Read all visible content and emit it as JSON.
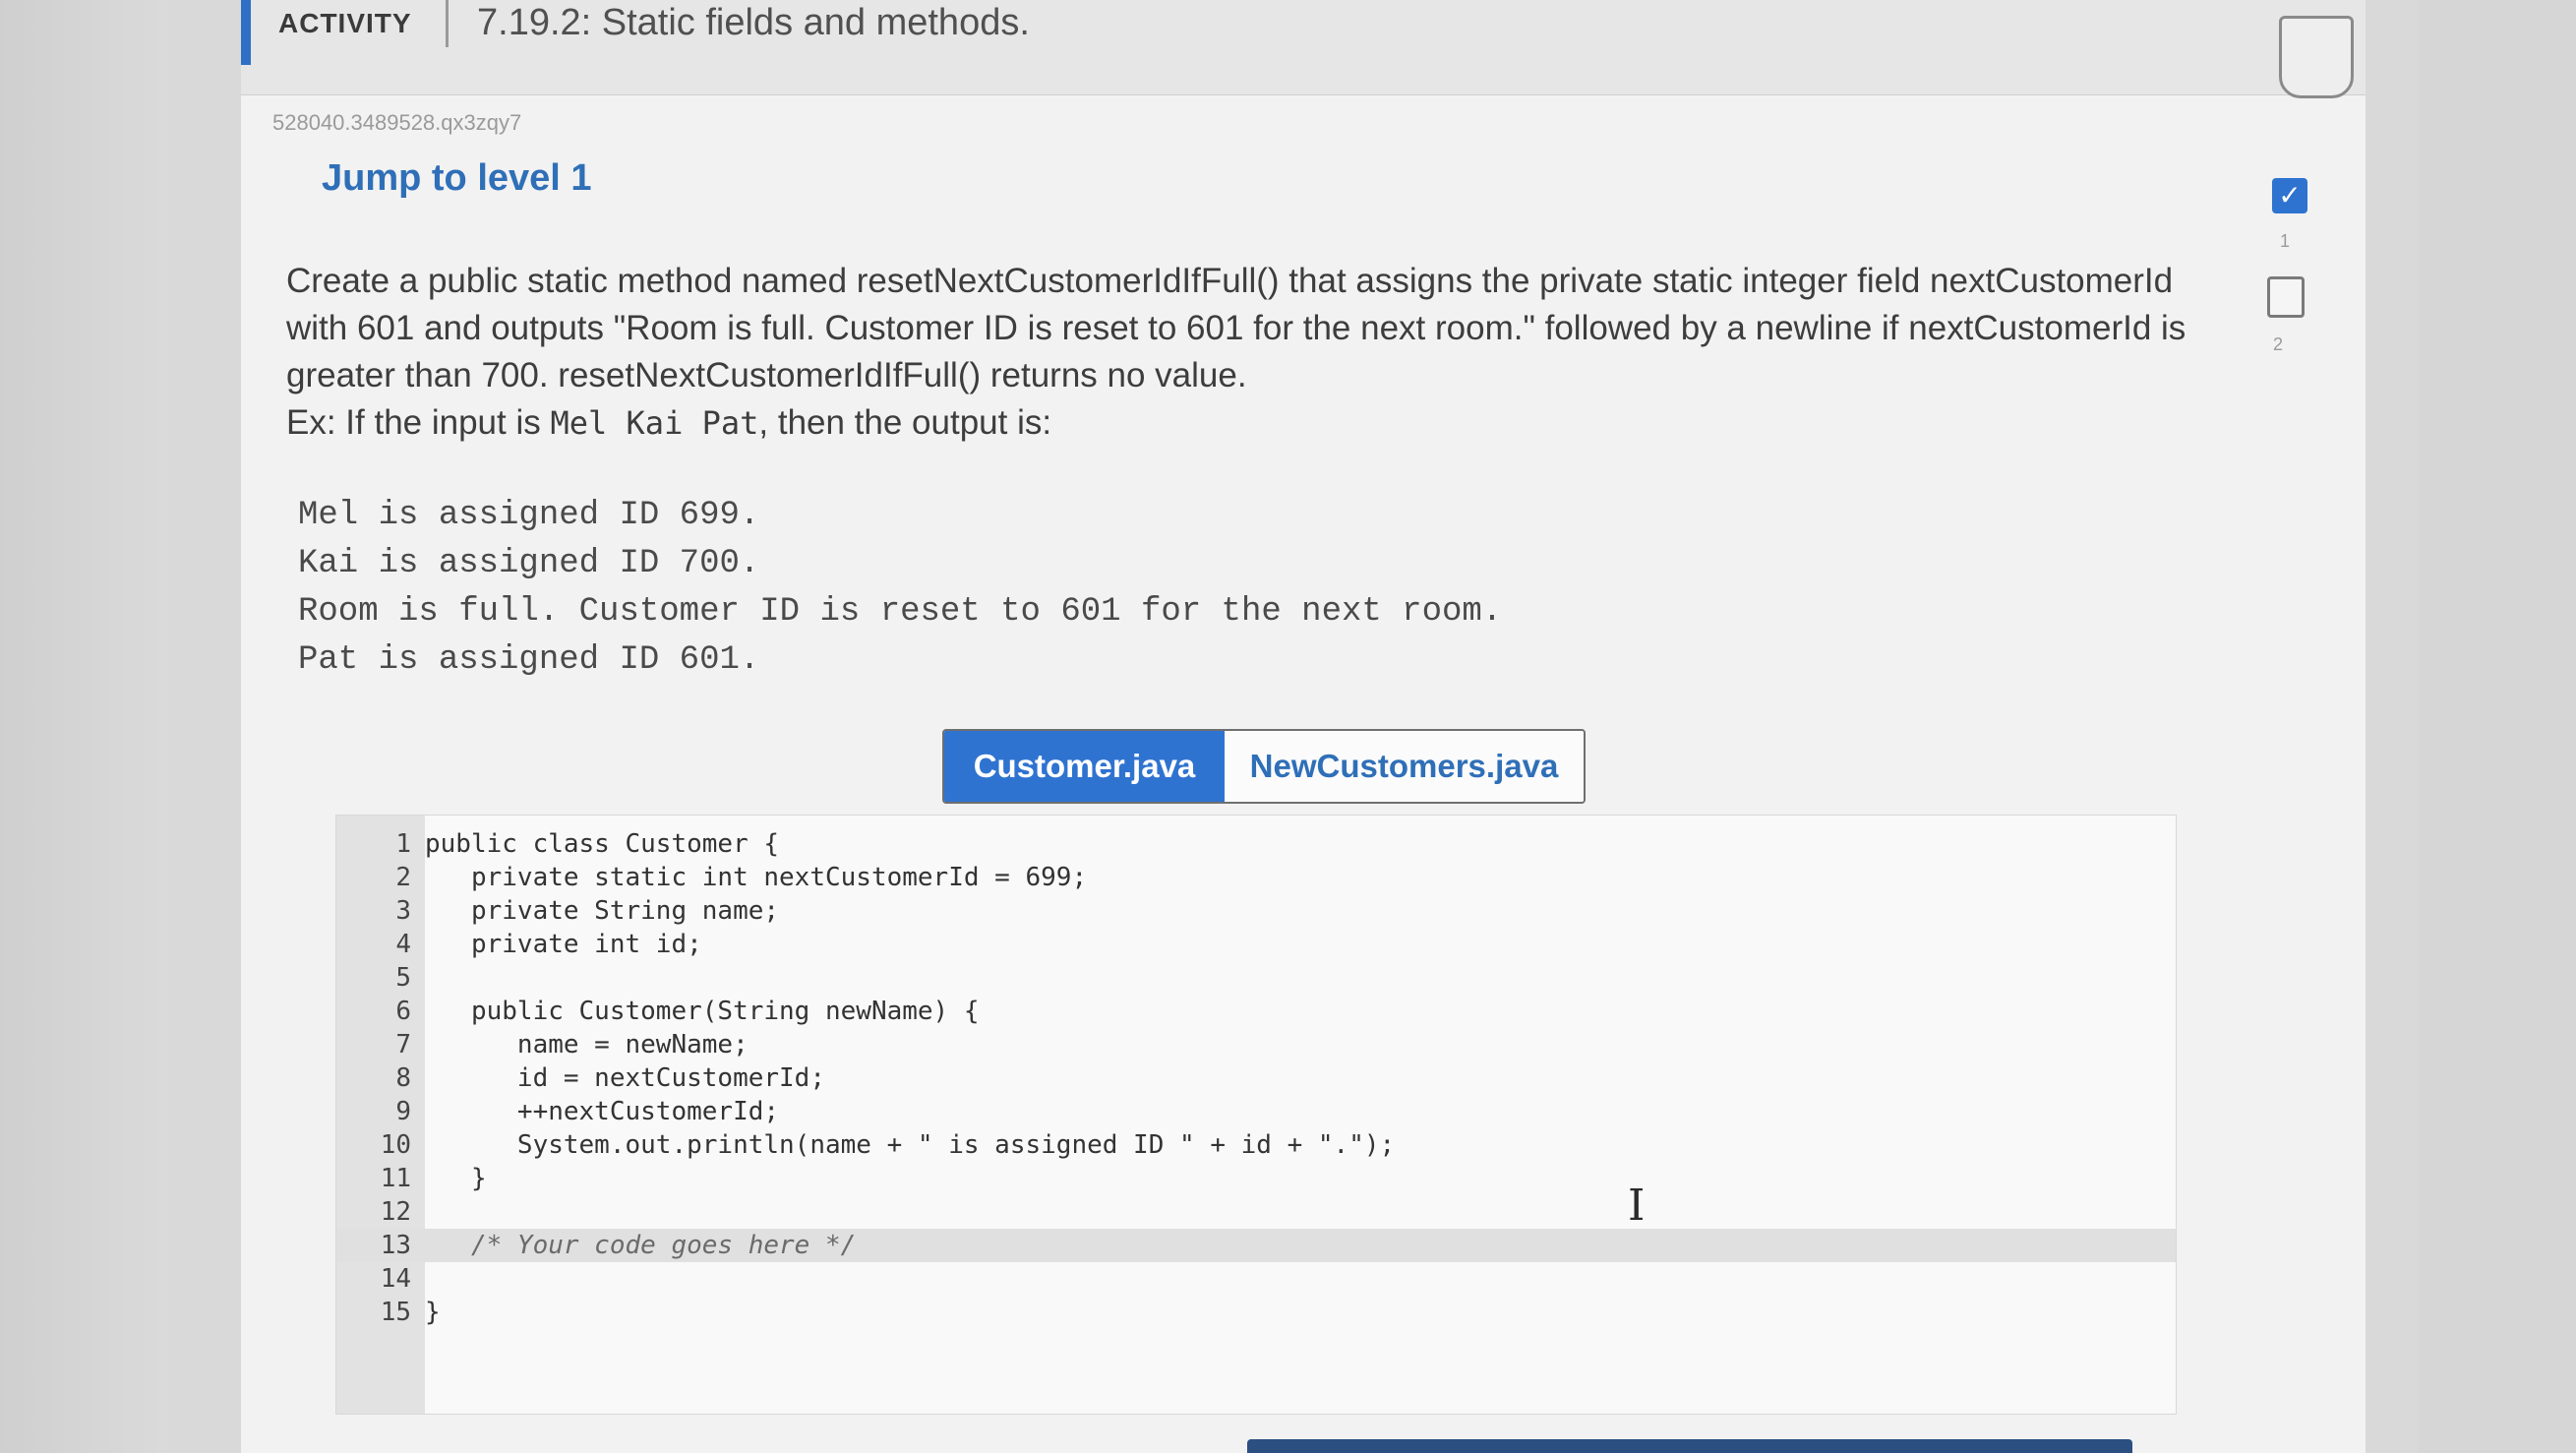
{
  "header": {
    "activity_label": "ACTIVITY",
    "title": "7.19.2: Static fields and methods."
  },
  "activity_id": "528040.3489528.qx3zqy7",
  "jump_level": "Jump to level 1",
  "levels": {
    "items": [
      {
        "number": "1",
        "completed": true
      },
      {
        "number": "2",
        "completed": false
      }
    ],
    "check_glyph": "✓"
  },
  "instructions": {
    "text": "Create a public static method named resetNextCustomerIdIfFull() that assigns the private static integer field nextCustomerId with 601 and outputs \"Room is full. Customer ID is reset to 601 for the next room.\" followed by a newline if nextCustomerId is greater than 700. resetNextCustomerIdIfFull() returns no value.",
    "example_prefix": "Ex: If the input is ",
    "example_input": "Mel Kai Pat",
    "example_suffix": ", then the output is:"
  },
  "sample_output": [
    "Mel is assigned ID 699.",
    "Kai is assigned ID 700.",
    "Room is full. Customer ID is reset to 601 for the next room.",
    "Pat is assigned ID 601."
  ],
  "tabs": [
    {
      "label": "Customer.java",
      "active": true
    },
    {
      "label": "NewCustomers.java",
      "active": false
    }
  ],
  "code_lines": [
    {
      "num": "1",
      "code": "public class Customer {"
    },
    {
      "num": "2",
      "code": "   private static int nextCustomerId = 699;"
    },
    {
      "num": "3",
      "code": "   private String name;"
    },
    {
      "num": "4",
      "code": "   private int id;"
    },
    {
      "num": "5",
      "code": ""
    },
    {
      "num": "6",
      "code": "   public Customer(String newName) {"
    },
    {
      "num": "7",
      "code": "      name = newName;"
    },
    {
      "num": "8",
      "code": "      id = nextCustomerId;"
    },
    {
      "num": "9",
      "code": "      ++nextCustomerId;"
    },
    {
      "num": "10",
      "code": "      System.out.println(name + \" is assigned ID \" + id + \".\");"
    },
    {
      "num": "11",
      "code": "   }"
    },
    {
      "num": "12",
      "code": ""
    },
    {
      "num": "13",
      "code": "   /* Your code goes here */"
    },
    {
      "num": "14",
      "code": ""
    },
    {
      "num": "15",
      "code": "}"
    }
  ],
  "active_line": "13",
  "icons": {
    "level_done": "checkmark-icon",
    "text_cursor": "text-cursor-icon",
    "text_cursor_glyph": "I"
  },
  "colors": {
    "accent": "#2f73d0",
    "link": "#2f6fb8"
  }
}
